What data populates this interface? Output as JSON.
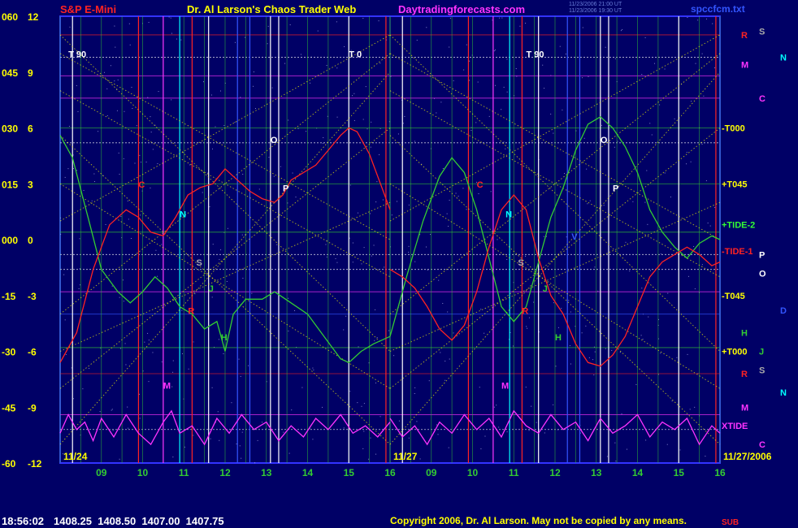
{
  "header": {
    "instrument": "S&P E-Mini",
    "title": "Dr. Al Larson's Chaos Trader Web",
    "site": "Daytradingforecasts.com",
    "timestamp1": "11/23/2006 21:00 UT",
    "timestamp2": "11/23/2006 19:30 UT",
    "filename": "spccfcm.txt"
  },
  "footer": {
    "time": "18:56:02",
    "quotes": "1408.25  1408.50  1407.00  1407.75",
    "copyright": "Copyright 2006, Dr. Al Larson. May not be copied by any means.",
    "tag": "SUB"
  },
  "colors": {
    "background": "#000066",
    "frame": "#3333ff",
    "white_line": "#ffffff",
    "red_line": "#ff2222",
    "green_line": "#33cc33",
    "magenta_line": "#ff33ff",
    "yellow": "#ffff00",
    "cyan": "#00ffff",
    "blue_line": "#3355ff"
  },
  "chart_data": {
    "type": "line",
    "y_axis_left_outer": [
      "060",
      "045",
      "030",
      "015",
      "000",
      "-15",
      "-30",
      "-45",
      "-60"
    ],
    "y_axis_left_inner": [
      "12",
      "9",
      "6",
      "3",
      "0",
      "-3",
      "-6",
      "-9",
      "-12"
    ],
    "ylim_left": [
      -60,
      60
    ],
    "panels": [
      {
        "date": "11/24",
        "hour_ticks": [
          "09",
          "10",
          "11",
          "12",
          "13",
          "14",
          "15",
          "16"
        ],
        "annotations": [
          {
            "label": "T 90",
            "color": "#ffffff",
            "h": 8.2,
            "y": 49
          },
          {
            "label": "T 0",
            "color": "#ffffff",
            "h": 15.0,
            "y": 49
          },
          {
            "label": "C",
            "color": "#ff2222",
            "h": 9.9,
            "y": 14
          },
          {
            "label": "N",
            "color": "#00ffff",
            "h": 10.9,
            "y": 6
          },
          {
            "label": "S",
            "color": "#aaaaaa",
            "h": 11.3,
            "y": -7
          },
          {
            "label": "J",
            "color": "#33cc33",
            "h": 11.6,
            "y": -14
          },
          {
            "label": "H",
            "color": "#33cc33",
            "h": 11.9,
            "y": -27
          },
          {
            "label": "O",
            "color": "#ffffff",
            "h": 13.1,
            "y": 26
          },
          {
            "label": "P",
            "color": "#ffffff",
            "h": 13.4,
            "y": 13
          },
          {
            "label": "M",
            "color": "#ff33ff",
            "h": 10.5,
            "y": -40
          },
          {
            "label": "R",
            "color": "#ff2222",
            "h": 11.1,
            "y": -20
          }
        ],
        "red": [
          [
            8.0,
            -33
          ],
          [
            8.4,
            -25
          ],
          [
            8.8,
            -8
          ],
          [
            9.2,
            4
          ],
          [
            9.6,
            8
          ],
          [
            9.9,
            6
          ],
          [
            10.2,
            2
          ],
          [
            10.5,
            1
          ],
          [
            10.8,
            6
          ],
          [
            11.1,
            12
          ],
          [
            11.4,
            14
          ],
          [
            11.7,
            15
          ],
          [
            12.0,
            19
          ],
          [
            12.3,
            16
          ],
          [
            12.6,
            13
          ],
          [
            12.9,
            11
          ],
          [
            13.2,
            10
          ],
          [
            13.4,
            12
          ],
          [
            13.6,
            16
          ],
          [
            13.9,
            18
          ],
          [
            14.2,
            20
          ],
          [
            14.5,
            24
          ],
          [
            14.8,
            28
          ],
          [
            15.0,
            30
          ],
          [
            15.2,
            29
          ],
          [
            15.5,
            23
          ],
          [
            15.8,
            14
          ],
          [
            16.0,
            8
          ]
        ],
        "green": [
          [
            8.0,
            28
          ],
          [
            8.3,
            22
          ],
          [
            8.7,
            5
          ],
          [
            9.0,
            -8
          ],
          [
            9.4,
            -14
          ],
          [
            9.7,
            -17
          ],
          [
            10.0,
            -14
          ],
          [
            10.3,
            -10
          ],
          [
            10.6,
            -13
          ],
          [
            10.9,
            -18
          ],
          [
            11.2,
            -20
          ],
          [
            11.5,
            -24
          ],
          [
            11.8,
            -22
          ],
          [
            12.0,
            -30
          ],
          [
            12.2,
            -20
          ],
          [
            12.5,
            -16
          ],
          [
            12.9,
            -16
          ],
          [
            13.2,
            -14
          ],
          [
            13.6,
            -17
          ],
          [
            14.0,
            -20
          ],
          [
            14.4,
            -26
          ],
          [
            14.8,
            -32
          ],
          [
            15.0,
            -33
          ],
          [
            15.3,
            -30
          ],
          [
            15.6,
            -28
          ],
          [
            16.0,
            -26
          ]
        ],
        "magenta": [
          [
            8.0,
            -52
          ],
          [
            8.2,
            -47
          ],
          [
            8.4,
            -51
          ],
          [
            8.6,
            -49
          ],
          [
            8.8,
            -54
          ],
          [
            9.0,
            -48
          ],
          [
            9.3,
            -53
          ],
          [
            9.6,
            -47
          ],
          [
            9.9,
            -52
          ],
          [
            10.2,
            -55
          ],
          [
            10.5,
            -49
          ],
          [
            10.7,
            -46
          ],
          [
            10.9,
            -52
          ],
          [
            11.2,
            -50
          ],
          [
            11.5,
            -55
          ],
          [
            11.8,
            -48
          ],
          [
            12.1,
            -52
          ],
          [
            12.4,
            -47
          ],
          [
            12.7,
            -51
          ],
          [
            13.0,
            -49
          ],
          [
            13.3,
            -54
          ],
          [
            13.6,
            -50
          ],
          [
            13.9,
            -53
          ],
          [
            14.2,
            -48
          ],
          [
            14.5,
            -51
          ],
          [
            14.8,
            -47
          ],
          [
            15.1,
            -52
          ],
          [
            15.4,
            -50
          ],
          [
            15.7,
            -53
          ],
          [
            16.0,
            -49
          ]
        ]
      },
      {
        "date": "11/27",
        "hour_ticks": [
          "09",
          "10",
          "11",
          "12",
          "13",
          "14",
          "15",
          "16"
        ],
        "annotations": [
          {
            "label": "T 90",
            "color": "#ffffff",
            "h": 11.3,
            "y": 49
          },
          {
            "label": "C",
            "color": "#ff2222",
            "h": 10.1,
            "y": 14
          },
          {
            "label": "N",
            "color": "#00ffff",
            "h": 10.8,
            "y": 6
          },
          {
            "label": "S",
            "color": "#aaaaaa",
            "h": 11.1,
            "y": -7
          },
          {
            "label": "J",
            "color": "#33cc33",
            "h": 11.7,
            "y": -14
          },
          {
            "label": "H",
            "color": "#33cc33",
            "h": 12.0,
            "y": -27
          },
          {
            "label": "O",
            "color": "#ffffff",
            "h": 13.1,
            "y": 26
          },
          {
            "label": "P",
            "color": "#ffffff",
            "h": 13.4,
            "y": 13
          },
          {
            "label": "M",
            "color": "#ff33ff",
            "h": 10.7,
            "y": -40
          },
          {
            "label": "R",
            "color": "#ff2222",
            "h": 11.2,
            "y": -20
          },
          {
            "label": "V",
            "color": "#3355ff",
            "h": 12.4,
            "y": 0
          }
        ],
        "red": [
          [
            8.0,
            -8
          ],
          [
            8.3,
            -10
          ],
          [
            8.6,
            -13
          ],
          [
            8.9,
            -18
          ],
          [
            9.2,
            -24
          ],
          [
            9.5,
            -27
          ],
          [
            9.8,
            -23
          ],
          [
            10.1,
            -14
          ],
          [
            10.4,
            -2
          ],
          [
            10.7,
            8
          ],
          [
            11.0,
            12
          ],
          [
            11.3,
            8
          ],
          [
            11.6,
            -5
          ],
          [
            11.9,
            -15
          ],
          [
            12.2,
            -20
          ],
          [
            12.5,
            -28
          ],
          [
            12.8,
            -33
          ],
          [
            13.1,
            -34
          ],
          [
            13.4,
            -31
          ],
          [
            13.7,
            -26
          ],
          [
            14.0,
            -18
          ],
          [
            14.3,
            -10
          ],
          [
            14.6,
            -6
          ],
          [
            14.9,
            -4
          ],
          [
            15.2,
            -2
          ],
          [
            15.5,
            -4
          ],
          [
            15.8,
            -7
          ],
          [
            16.0,
            -6
          ]
        ],
        "green": [
          [
            8.0,
            -26
          ],
          [
            8.4,
            -10
          ],
          [
            8.8,
            5
          ],
          [
            9.2,
            17
          ],
          [
            9.5,
            22
          ],
          [
            9.8,
            18
          ],
          [
            10.1,
            8
          ],
          [
            10.4,
            -5
          ],
          [
            10.7,
            -18
          ],
          [
            11.0,
            -22
          ],
          [
            11.3,
            -18
          ],
          [
            11.6,
            -6
          ],
          [
            11.9,
            6
          ],
          [
            12.2,
            14
          ],
          [
            12.5,
            24
          ],
          [
            12.8,
            31
          ],
          [
            13.1,
            33
          ],
          [
            13.4,
            30
          ],
          [
            13.7,
            25
          ],
          [
            14.0,
            18
          ],
          [
            14.3,
            8
          ],
          [
            14.6,
            2
          ],
          [
            14.9,
            -2
          ],
          [
            15.2,
            -5
          ],
          [
            15.5,
            -1
          ],
          [
            15.8,
            1
          ],
          [
            16.0,
            0
          ]
        ],
        "magenta": [
          [
            8.0,
            -48
          ],
          [
            8.3,
            -53
          ],
          [
            8.6,
            -50
          ],
          [
            8.9,
            -55
          ],
          [
            9.2,
            -49
          ],
          [
            9.5,
            -52
          ],
          [
            9.8,
            -47
          ],
          [
            10.1,
            -51
          ],
          [
            10.4,
            -48
          ],
          [
            10.7,
            -53
          ],
          [
            11.0,
            -46
          ],
          [
            11.3,
            -50
          ],
          [
            11.6,
            -52
          ],
          [
            11.9,
            -47
          ],
          [
            12.2,
            -51
          ],
          [
            12.5,
            -49
          ],
          [
            12.8,
            -54
          ],
          [
            13.1,
            -48
          ],
          [
            13.4,
            -52
          ],
          [
            13.7,
            -50
          ],
          [
            14.0,
            -47
          ],
          [
            14.3,
            -53
          ],
          [
            14.6,
            -49
          ],
          [
            14.9,
            -51
          ],
          [
            15.2,
            -48
          ],
          [
            15.5,
            -55
          ],
          [
            15.8,
            -50
          ],
          [
            16.0,
            -52
          ]
        ]
      }
    ],
    "horizontal_levels": [
      {
        "y": 55,
        "color": "#ff2222"
      },
      {
        "y": 49,
        "color": "#ffffff"
      },
      {
        "y": 44,
        "color": "#ff33ff"
      },
      {
        "y": 38,
        "color": "#ff33ff"
      },
      {
        "y": 30,
        "color": "#33cc33"
      },
      {
        "y": 26,
        "color": "#ffffff"
      },
      {
        "y": 15,
        "color": "#33cc33"
      },
      {
        "y": 2,
        "color": "#33cc33"
      },
      {
        "y": -4,
        "color": "#ffffff"
      },
      {
        "y": -8,
        "color": "#ffffff"
      },
      {
        "y": -14,
        "color": "#ff33ff"
      },
      {
        "y": -20,
        "color": "#3355ff"
      },
      {
        "y": -29,
        "color": "#33cc33"
      },
      {
        "y": -36,
        "color": "#ff2222"
      },
      {
        "y": -47,
        "color": "#ff33ff"
      },
      {
        "y": -51,
        "color": "#ffffff"
      }
    ],
    "right_labels": [
      {
        "label": "R",
        "color": "#ff2222",
        "col": 0,
        "y": 55
      },
      {
        "label": "S",
        "color": "#aaaaaa",
        "col": 1,
        "y": 56
      },
      {
        "label": "N",
        "color": "#00ffff",
        "col": 2,
        "y": 49
      },
      {
        "label": "M",
        "color": "#ff33ff",
        "col": 0,
        "y": 47
      },
      {
        "label": "C",
        "color": "#ff33ff",
        "col": 1,
        "y": 38
      },
      {
        "label": "-T000",
        "color": "#ffff00",
        "col": 0,
        "y": 30
      },
      {
        "label": "+T045",
        "color": "#ffff00",
        "col": 0,
        "y": 15
      },
      {
        "label": "+TIDE-2",
        "color": "#33ff33",
        "col": 0,
        "y": 4
      },
      {
        "label": "-TIDE-1",
        "color": "#ff2222",
        "col": 0,
        "y": -3
      },
      {
        "label": "P",
        "color": "#ffffff",
        "col": 1,
        "y": -4
      },
      {
        "label": "O",
        "color": "#ffffff",
        "col": 1,
        "y": -9
      },
      {
        "label": "-T045",
        "color": "#ffff00",
        "col": 0,
        "y": -15
      },
      {
        "label": "D",
        "color": "#3355ff",
        "col": 2,
        "y": -19
      },
      {
        "label": "H",
        "color": "#33cc33",
        "col": 0,
        "y": -25
      },
      {
        "label": "+T000",
        "color": "#ffff00",
        "col": 0,
        "y": -30
      },
      {
        "label": "J",
        "color": "#33cc33",
        "col": 1,
        "y": -30
      },
      {
        "label": "R",
        "color": "#ff2222",
        "col": 0,
        "y": -36
      },
      {
        "label": "S",
        "color": "#aaaaaa",
        "col": 1,
        "y": -35
      },
      {
        "label": "N",
        "color": "#00ffff",
        "col": 2,
        "y": -41
      },
      {
        "label": "M",
        "color": "#ff33ff",
        "col": 0,
        "y": -45
      },
      {
        "label": "XTIDE",
        "color": "#ff33ff",
        "col": 0,
        "y": -50
      },
      {
        "label": "C",
        "color": "#ff33ff",
        "col": 1,
        "y": -55
      }
    ],
    "end_date": "11/27/2006"
  }
}
